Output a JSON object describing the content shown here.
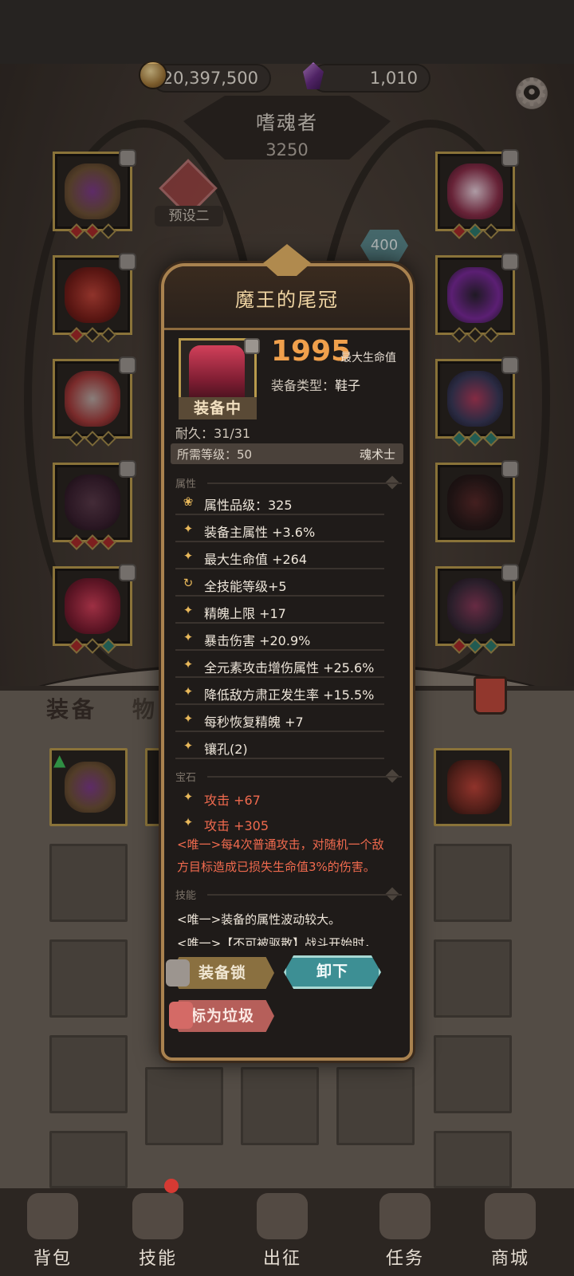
{
  "currency": {
    "gold": "20,397,500",
    "gems": "1,010"
  },
  "hero": {
    "name": "嗜魂者",
    "power": "3250",
    "preset_label": "预设二",
    "badge_value": "400"
  },
  "bag_tabs": {
    "equipment": "装备",
    "items": "物品"
  },
  "popup": {
    "title": "魔王的尾冠",
    "status": "装备中",
    "main_value": "1995",
    "main_label": "最大生命值",
    "type_label": "装备类型：",
    "type_value": "鞋子",
    "durability": "耐久：31/31",
    "required_level": "所需等级：50",
    "class": "魂术士",
    "sections": {
      "attributes": "属性",
      "gems": "宝石",
      "skills": "技能"
    },
    "attributes": [
      {
        "icon": "quality-icon",
        "text": "属性品级：325"
      },
      {
        "icon": "star-icon",
        "text": "装备主属性 +3.6%"
      },
      {
        "icon": "star-icon",
        "text": "最大生命值 +264"
      },
      {
        "icon": "cycle-icon",
        "text": "全技能等级+5"
      },
      {
        "icon": "star-icon",
        "text": "精魄上限 +17"
      },
      {
        "icon": "star-icon",
        "text": "暴击伤害 +20.9%"
      },
      {
        "icon": "star-icon",
        "text": "全元素攻击增伤属性 +25.6%"
      },
      {
        "icon": "star-icon",
        "text": "降低敌方肃正发生率 +15.5%"
      },
      {
        "icon": "star-icon",
        "text": "每秒恢复精魄 +7"
      },
      {
        "icon": "star-icon",
        "text": "镶孔(2)"
      }
    ],
    "gems": [
      {
        "icon": "star-icon",
        "text": "攻击 +67"
      },
      {
        "icon": "star-icon",
        "text": "攻击 +305"
      }
    ],
    "unique_line1": "<唯一>每4次普通攻击，对随机一个敌",
    "unique_line2": "方目标造成已损失生命值3%的伤害。",
    "skill_line1": "<唯一>装备的属性波动较大。",
    "skill_line2": "<唯一>【不可被驱散】战斗开始时，",
    "buttons": {
      "lock": "装备锁",
      "unequip": "卸下",
      "junk": "标为垃圾"
    }
  },
  "nav": [
    {
      "label": "背包",
      "icon": "backpack-icon"
    },
    {
      "label": "技能",
      "icon": "skill-book-icon"
    },
    {
      "label": "出征",
      "icon": "sword-map-icon"
    },
    {
      "label": "任务",
      "icon": "scroll-icon"
    },
    {
      "label": "商城",
      "icon": "shop-crown-icon"
    }
  ],
  "colors": {
    "gold_frame": "#b89a4c",
    "stat_orange": "#f0a04c",
    "unique_red": "#f06a4e",
    "unequip_teal": "#3d8f94"
  }
}
